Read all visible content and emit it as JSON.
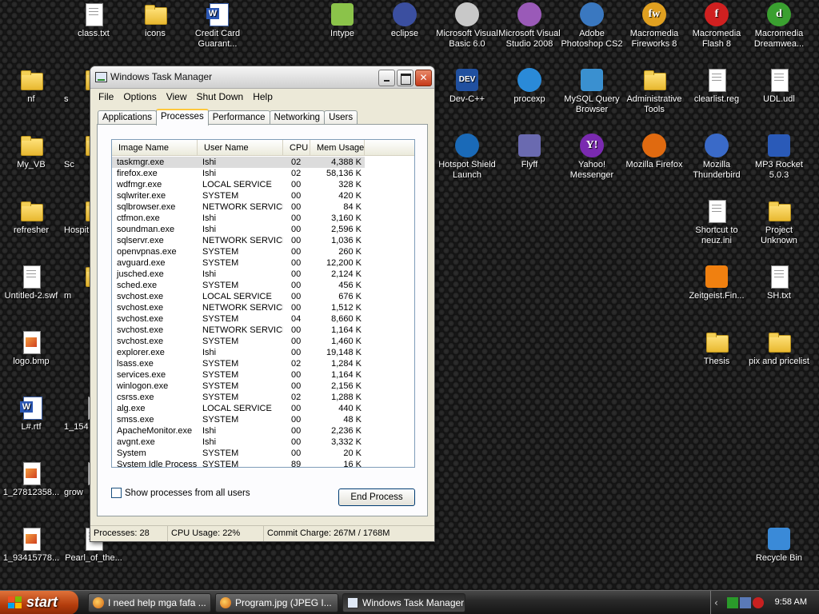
{
  "desktop_icons": [
    {
      "label": "class.txt",
      "icon": "text-file-icon"
    },
    {
      "label": "icons",
      "icon": "folder-icon"
    },
    {
      "label": "Credit Card Guarant...",
      "icon": "word-document-icon"
    },
    {
      "label": "Intype",
      "icon": "intype-icon"
    },
    {
      "label": "eclipse",
      "icon": "eclipse-icon"
    },
    {
      "label": "Microsoft Visual Basic 6.0",
      "icon": "visual-basic-icon"
    },
    {
      "label": "Microsoft Visual Studio 2008",
      "icon": "visual-studio-icon"
    },
    {
      "label": "Adobe Photoshop CS2",
      "icon": "photoshop-icon"
    },
    {
      "label": "Macromedia Fireworks 8",
      "icon": "fireworks-icon"
    },
    {
      "label": "Macromedia Flash 8",
      "icon": "flash-icon"
    },
    {
      "label": "Macromedia Dreamwea...",
      "icon": "dreamweaver-icon"
    },
    {
      "label": "nf",
      "icon": "folder-icon"
    },
    {
      "label": "Dev-C++",
      "icon": "devcpp-icon"
    },
    {
      "label": "procexp",
      "icon": "procexp-icon"
    },
    {
      "label": "MySQL Query Browser",
      "icon": "mysql-icon"
    },
    {
      "label": "Administrative Tools",
      "icon": "admin-tools-icon"
    },
    {
      "label": "clearlist.reg",
      "icon": "registry-file-icon"
    },
    {
      "label": "UDL.udl",
      "icon": "udl-file-icon"
    },
    {
      "label": "My_VB",
      "icon": "folder-icon"
    },
    {
      "label": "Hotspot Shield Launch",
      "icon": "hotspot-shield-icon"
    },
    {
      "label": "Flyff",
      "icon": "flyff-icon"
    },
    {
      "label": "Yahoo! Messenger",
      "icon": "yahoo-messenger-icon"
    },
    {
      "label": "Mozilla Firefox",
      "icon": "firefox-icon"
    },
    {
      "label": "Mozilla Thunderbird",
      "icon": "thunderbird-icon"
    },
    {
      "label": "MP3 Rocket 5.0.3",
      "icon": "mp3-rocket-icon"
    },
    {
      "label": "refresher",
      "icon": "folder-icon"
    },
    {
      "label": "Shortcut to neuz.ini",
      "icon": "ini-file-icon"
    },
    {
      "label": "Project Unknown",
      "icon": "folder-icon"
    },
    {
      "label": "Untitled-2.swf",
      "icon": "swf-file-icon"
    },
    {
      "label": "Zeitgeist.Fin...",
      "icon": "vlc-icon"
    },
    {
      "label": "SH.txt",
      "icon": "text-file-icon"
    },
    {
      "label": "logo.bmp",
      "icon": "bitmap-file-icon"
    },
    {
      "label": "Thesis",
      "icon": "folder-icon"
    },
    {
      "label": "pix and pricelist",
      "icon": "folder-icon"
    },
    {
      "label": "L#.rtf",
      "icon": "rtf-file-icon"
    },
    {
      "label": "1_27812358...",
      "icon": "image-file-icon"
    },
    {
      "label": "1_93415778...",
      "icon": "image-file-icon"
    },
    {
      "label": "Pearl_of_the...",
      "icon": "video-file-icon"
    },
    {
      "label": "Recycle Bin",
      "icon": "recycle-bin-icon"
    },
    {
      "label": "Sc",
      "icon": "folder-icon"
    },
    {
      "label": "Hospit",
      "icon": "folder-icon"
    },
    {
      "label": "m",
      "icon": "folder-icon"
    },
    {
      "label": "1_154",
      "icon": "image-file-icon"
    },
    {
      "label": "grow",
      "icon": "image-file-icon"
    },
    {
      "label": "s",
      "icon": "folder-icon"
    }
  ],
  "window": {
    "title": "Windows Task Manager",
    "menu": [
      "File",
      "Options",
      "View",
      "Shut Down",
      "Help"
    ],
    "tabs": [
      "Applications",
      "Processes",
      "Performance",
      "Networking",
      "Users"
    ],
    "active_tab": "Processes",
    "columns": [
      "Image Name",
      "User Name",
      "CPU",
      "Mem Usage"
    ],
    "processes": [
      {
        "name": "taskmgr.exe",
        "user": "Ishi",
        "cpu": "02",
        "mem": "4,388 K"
      },
      {
        "name": "firefox.exe",
        "user": "Ishi",
        "cpu": "02",
        "mem": "58,136 K"
      },
      {
        "name": "wdfmgr.exe",
        "user": "LOCAL SERVICE",
        "cpu": "00",
        "mem": "328 K"
      },
      {
        "name": "sqlwriter.exe",
        "user": "SYSTEM",
        "cpu": "00",
        "mem": "420 K"
      },
      {
        "name": "sqlbrowser.exe",
        "user": "NETWORK SERVICE",
        "cpu": "00",
        "mem": "84 K"
      },
      {
        "name": "ctfmon.exe",
        "user": "Ishi",
        "cpu": "00",
        "mem": "3,160 K"
      },
      {
        "name": "soundman.exe",
        "user": "Ishi",
        "cpu": "00",
        "mem": "2,596 K"
      },
      {
        "name": "sqlservr.exe",
        "user": "NETWORK SERVICE",
        "cpu": "00",
        "mem": "1,036 K"
      },
      {
        "name": "openvpnas.exe",
        "user": "SYSTEM",
        "cpu": "00",
        "mem": "260 K"
      },
      {
        "name": "avguard.exe",
        "user": "SYSTEM",
        "cpu": "00",
        "mem": "12,200 K"
      },
      {
        "name": "jusched.exe",
        "user": "Ishi",
        "cpu": "00",
        "mem": "2,124 K"
      },
      {
        "name": "sched.exe",
        "user": "SYSTEM",
        "cpu": "00",
        "mem": "456 K"
      },
      {
        "name": "svchost.exe",
        "user": "LOCAL SERVICE",
        "cpu": "00",
        "mem": "676 K"
      },
      {
        "name": "svchost.exe",
        "user": "NETWORK SERVICE",
        "cpu": "00",
        "mem": "1,512 K"
      },
      {
        "name": "svchost.exe",
        "user": "SYSTEM",
        "cpu": "04",
        "mem": "8,660 K"
      },
      {
        "name": "svchost.exe",
        "user": "NETWORK SERVICE",
        "cpu": "00",
        "mem": "1,164 K"
      },
      {
        "name": "svchost.exe",
        "user": "SYSTEM",
        "cpu": "00",
        "mem": "1,460 K"
      },
      {
        "name": "explorer.exe",
        "user": "Ishi",
        "cpu": "00",
        "mem": "19,148 K"
      },
      {
        "name": "lsass.exe",
        "user": "SYSTEM",
        "cpu": "02",
        "mem": "1,284 K"
      },
      {
        "name": "services.exe",
        "user": "SYSTEM",
        "cpu": "00",
        "mem": "1,164 K"
      },
      {
        "name": "winlogon.exe",
        "user": "SYSTEM",
        "cpu": "00",
        "mem": "2,156 K"
      },
      {
        "name": "csrss.exe",
        "user": "SYSTEM",
        "cpu": "02",
        "mem": "1,288 K"
      },
      {
        "name": "alg.exe",
        "user": "LOCAL SERVICE",
        "cpu": "00",
        "mem": "440 K"
      },
      {
        "name": "smss.exe",
        "user": "SYSTEM",
        "cpu": "00",
        "mem": "48 K"
      },
      {
        "name": "ApacheMonitor.exe",
        "user": "Ishi",
        "cpu": "00",
        "mem": "2,236 K"
      },
      {
        "name": "avgnt.exe",
        "user": "Ishi",
        "cpu": "00",
        "mem": "3,332 K"
      },
      {
        "name": "System",
        "user": "SYSTEM",
        "cpu": "00",
        "mem": "20 K"
      },
      {
        "name": "System Idle Process",
        "user": "SYSTEM",
        "cpu": "89",
        "mem": "16 K"
      }
    ],
    "selected_process": "taskmgr.exe",
    "show_all_label": "Show processes from all users",
    "end_process_label": "End Process",
    "status": {
      "processes": "Processes: 28",
      "cpu": "CPU Usage: 22%",
      "commit": "Commit Charge: 267M / 1768M"
    }
  },
  "taskbar": {
    "start_label": "start",
    "tasks": [
      {
        "label": "I need help mga fafa ...",
        "icon": "firefox-icon"
      },
      {
        "label": "Program.jpg (JPEG I...",
        "icon": "firefox-icon"
      },
      {
        "label": "Windows Task Manager",
        "icon": "task-manager-icon"
      }
    ],
    "clock": "9:58 AM"
  }
}
